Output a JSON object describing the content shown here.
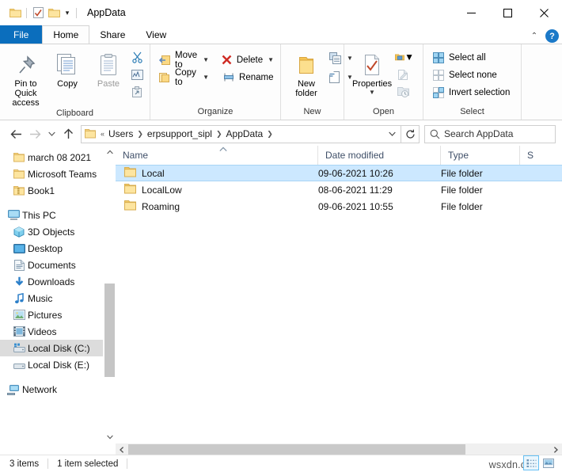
{
  "window": {
    "title": "AppData",
    "quick_access": [
      "folder-icon",
      "properties-icon",
      "new-folder-icon"
    ],
    "controls": {
      "minimize": "minimize-icon",
      "maximize": "maximize-icon",
      "close": "close-icon"
    }
  },
  "ribbon": {
    "tabs": [
      {
        "label": "File",
        "id": "file"
      },
      {
        "label": "Home",
        "id": "home"
      },
      {
        "label": "Share",
        "id": "share"
      },
      {
        "label": "View",
        "id": "view"
      }
    ],
    "active_tab": "Home",
    "collapse_icon": "chevron-up-icon",
    "help_label": "?",
    "groups": [
      {
        "name": "Clipboard",
        "big": [
          {
            "label": "Pin to Quick access",
            "icon": "pin-icon"
          },
          {
            "label": "Copy",
            "icon": "copy-icon"
          },
          {
            "label": "Paste",
            "icon": "paste-icon"
          }
        ],
        "small_icons": [
          "cut-icon",
          "copy-path-icon",
          "paste-shortcut-icon"
        ]
      },
      {
        "name": "Organize",
        "items": [
          {
            "label": "Move to",
            "icon": "move-to-icon",
            "caret": true
          },
          {
            "label": "Copy to",
            "icon": "copy-to-icon",
            "caret": true
          },
          {
            "label": "Delete",
            "icon": "delete-icon",
            "caret": true
          },
          {
            "label": "Rename",
            "icon": "rename-icon",
            "caret": false
          }
        ]
      },
      {
        "name": "New",
        "big": [
          {
            "label": "New folder",
            "icon": "new-folder-icon"
          }
        ],
        "small_icons": [
          "new-item-icon",
          "easy-access-icon"
        ]
      },
      {
        "name": "Open",
        "big": [
          {
            "label": "Properties",
            "icon": "properties-icon"
          }
        ],
        "small_icons": [
          "open-icon",
          "edit-icon",
          "history-icon"
        ]
      },
      {
        "name": "Select",
        "items": [
          {
            "label": "Select all",
            "icon": "select-all-icon"
          },
          {
            "label": "Select none",
            "icon": "select-none-icon"
          },
          {
            "label": "Invert selection",
            "icon": "invert-selection-icon"
          }
        ]
      }
    ]
  },
  "address_bar": {
    "back_icon": "back-arrow-icon",
    "forward_icon": "forward-arrow-icon",
    "recent_icon": "chevron-down-icon",
    "up_icon": "up-arrow-icon",
    "overflow": "«",
    "crumbs": [
      "Users",
      "erpsupport_sipl",
      "AppData"
    ],
    "dropdown_icon": "chevron-down-icon",
    "refresh_icon": "refresh-icon",
    "search_placeholder": "Search AppData",
    "search_value": "",
    "search_icon": "search-icon"
  },
  "nav_pane": {
    "items": [
      {
        "label": "march 08 2021",
        "icon": "folder-icon",
        "indent": 1,
        "selected": false
      },
      {
        "label": "Microsoft Teams",
        "icon": "folder-icon",
        "indent": 1,
        "selected": false
      },
      {
        "label": "Book1",
        "icon": "zip-folder-icon",
        "indent": 1,
        "selected": false
      },
      {
        "gap": true
      },
      {
        "label": "This PC",
        "icon": "this-pc-icon",
        "indent": 0,
        "selected": false
      },
      {
        "label": "3D Objects",
        "icon": "3d-objects-icon",
        "indent": 1,
        "selected": false
      },
      {
        "label": "Desktop",
        "icon": "desktop-icon",
        "indent": 1,
        "selected": false
      },
      {
        "label": "Documents",
        "icon": "documents-icon",
        "indent": 1,
        "selected": false
      },
      {
        "label": "Downloads",
        "icon": "downloads-icon",
        "indent": 1,
        "selected": false
      },
      {
        "label": "Music",
        "icon": "music-icon",
        "indent": 1,
        "selected": false
      },
      {
        "label": "Pictures",
        "icon": "pictures-icon",
        "indent": 1,
        "selected": false
      },
      {
        "label": "Videos",
        "icon": "videos-icon",
        "indent": 1,
        "selected": false
      },
      {
        "label": "Local Disk (C:)",
        "icon": "system-drive-icon",
        "indent": 1,
        "selected": true
      },
      {
        "label": "Local Disk (E:)",
        "icon": "drive-icon",
        "indent": 1,
        "selected": false
      },
      {
        "gap": true
      },
      {
        "label": "Network",
        "icon": "network-icon",
        "indent": 0,
        "selected": false
      }
    ],
    "scroll_up_icon": "chevron-up-icon",
    "scroll_down_icon": "chevron-down-icon"
  },
  "file_list": {
    "columns": [
      {
        "label": "Name",
        "sorted": true,
        "sort_dir": "asc"
      },
      {
        "label": "Date modified"
      },
      {
        "label": "Type"
      },
      {
        "label": "S"
      }
    ],
    "rows": [
      {
        "name": "Local",
        "date": "09-06-2021 10:26",
        "type": "File folder",
        "icon": "folder-icon",
        "selected": true
      },
      {
        "name": "LocalLow",
        "date": "08-06-2021 11:29",
        "type": "File folder",
        "icon": "folder-icon",
        "selected": false
      },
      {
        "name": "Roaming",
        "date": "09-06-2021 10:55",
        "type": "File folder",
        "icon": "folder-icon",
        "selected": false
      }
    ]
  },
  "status_bar": {
    "item_count": "3 items",
    "selection": "1 item selected",
    "view_details_icon": "details-view-icon",
    "view_large_icon": "large-icons-view-icon"
  },
  "watermark": {
    "text": "wsxdn.com"
  },
  "colors": {
    "file_tab": "#0b6ebd",
    "selection": "#cce8ff",
    "nav_selection": "#dcdcdc",
    "folder": "#fcdf8e",
    "header_text": "#3f4f68"
  }
}
